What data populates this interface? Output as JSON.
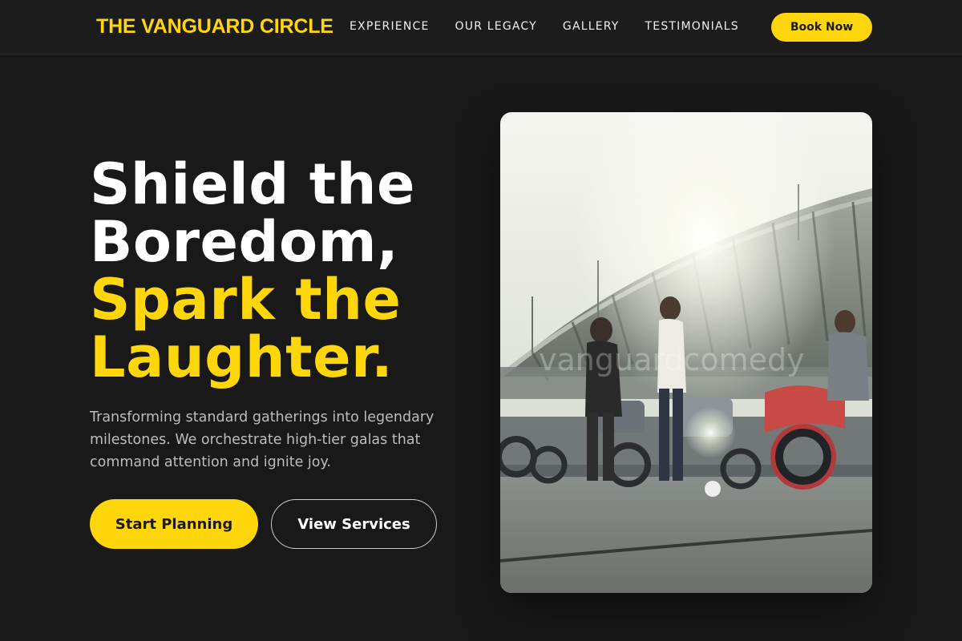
{
  "header": {
    "brand": "THE VANGUARD CIRCLE",
    "nav": [
      "EXPERIENCE",
      "OUR LEGACY",
      "GALLERY",
      "TESTIMONIALS"
    ],
    "cta": "Book Now"
  },
  "hero": {
    "headline_line1": "Shield the",
    "headline_line2": "Boredom,",
    "headline_line3": "Spark the",
    "headline_line4": "Laughter.",
    "subtext": "Transforming standard gatherings into legendary milestones. We orchestrate high-tier galas that command attention and ignite joy.",
    "primary_button": "Start Planning",
    "secondary_button": "View Services",
    "image_watermark": "vanguardcomedy"
  },
  "colors": {
    "accent": "#ffd60a",
    "background": "#191919",
    "header_background": "#1c1c1c"
  }
}
